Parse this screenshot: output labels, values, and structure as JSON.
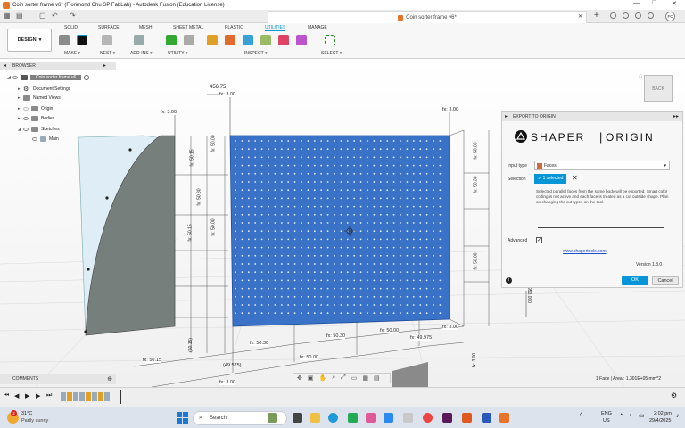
{
  "window": {
    "title": "Coin sorter frame v6* (Florimond Chu SP FabLab) - Autodesk Fusion (Education License)",
    "tab_title": "Coin sorter frame v6*"
  },
  "ribbon": {
    "design_label": "DESIGN",
    "tabs": [
      "SOLID",
      "SURFACE",
      "MESH",
      "SHEET METAL",
      "PLASTIC",
      "UTILITIES",
      "MANAGE"
    ],
    "active_tab": "UTILITIES",
    "groups": [
      "MAKE",
      "NEST",
      "ADD-INS",
      "UTILITY",
      "INSPECT",
      "SELECT"
    ]
  },
  "browser": {
    "header": "BROWSER",
    "root": "Coin sorter frame v6",
    "items": [
      "Document Settings",
      "Named Views",
      "Origin",
      "Bodies",
      "Sketches",
      "Main"
    ]
  },
  "viewcube": {
    "face": "BACK"
  },
  "dimensions": {
    "top_width": "456.75",
    "labels": [
      "fx: 3.00",
      "fx: 3.00",
      "fx: 3.00",
      "fx: 50.00",
      "fx: 50.15",
      "fx: 50.30",
      "fx: 50.30",
      "fx: 50.00",
      "fx: 50.00",
      "fx: 50.15",
      "fx: 50.00",
      "fx: 50.30",
      "fx: 50.30",
      "fx: 50.00",
      "fx: 50.15",
      "fx: 50.00",
      "fx: 49.975",
      "fx: 3.00",
      "fx: 3.00",
      "fx: 3.00",
      "(49.575)",
      "(50.15)",
      "950.000"
    ]
  },
  "panel": {
    "header": "EXPORT TO ORIGIN",
    "logo_left": "SHAPER",
    "logo_right": "ORIGIN",
    "input_type_label": "Input type",
    "input_type_value": "Faces",
    "selection_label": "Selection",
    "selection_value": "1 selected",
    "description": "Selected parallel faces from the same body will be exported. Smart color coding is not active and each face is treated as a cut outside shape. Plan on changing the cut types on the tool.",
    "advanced_label": "Advanced",
    "link": "www.shapertools.com",
    "version": "Version 1.8.0",
    "ok": "OK",
    "cancel": "Cancel"
  },
  "comments": {
    "label": "COMMENTS"
  },
  "status": {
    "text": "1 Face | Area : 1.301E+05 mm^2"
  },
  "taskbar": {
    "weather_temp": "31°C",
    "weather_desc": "Partly sunny",
    "search_placeholder": "Search",
    "lang_line1": "ENG",
    "lang_line2": "US",
    "time": "2:02 pm",
    "date": "29/4/2025",
    "badge": "2"
  }
}
